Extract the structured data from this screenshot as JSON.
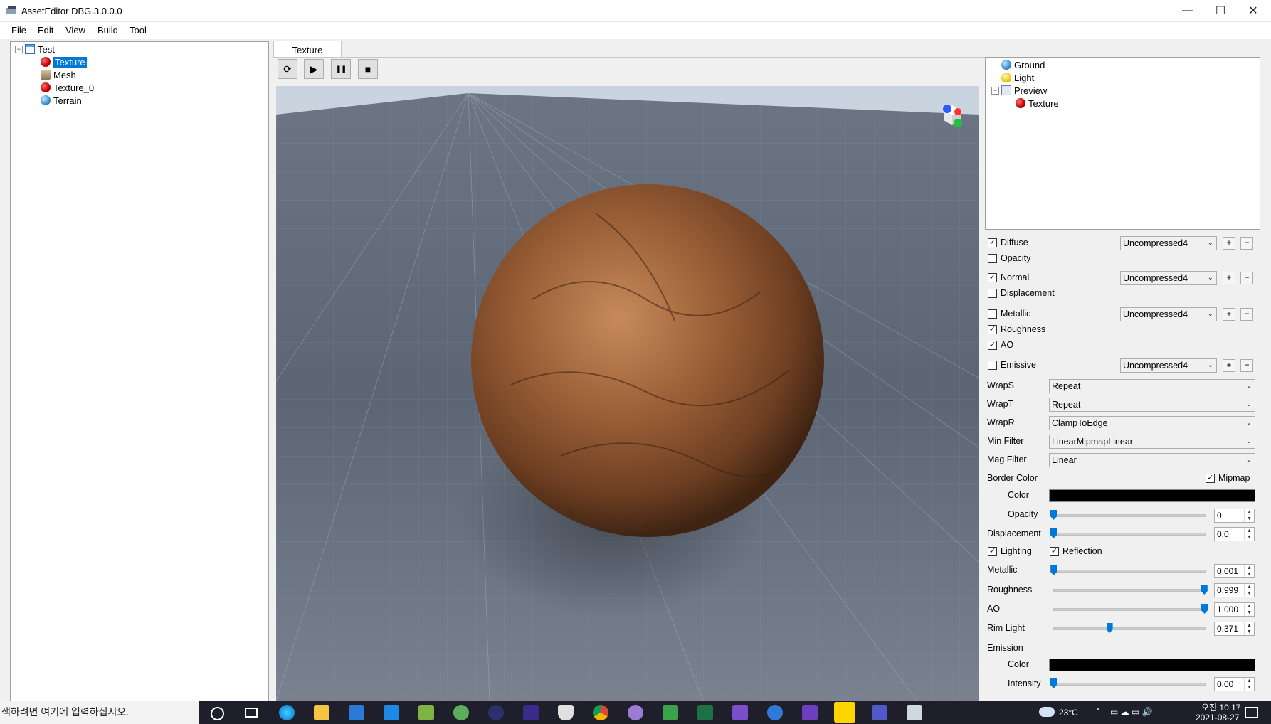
{
  "window": {
    "title": "AssetEditor DBG.3.0.0.0",
    "min_glyph": "—",
    "max_glyph": "☐",
    "close_glyph": "✕"
  },
  "menu": [
    "File",
    "Edit",
    "View",
    "Build",
    "Tool"
  ],
  "asset_tree": {
    "root": "Test",
    "items": [
      "Texture",
      "Mesh",
      "Texture_0",
      "Terrain"
    ],
    "selected": "Texture"
  },
  "tab": {
    "label": "Texture"
  },
  "toolbar": {
    "reload_icon": "⟳",
    "play_icon": "▶",
    "pause_icon": "❚❚",
    "stop_icon": "■"
  },
  "scene_tree": {
    "items": [
      "Ground",
      "Light",
      "Preview"
    ],
    "child": "Texture"
  },
  "maps": [
    {
      "label": "Diffuse",
      "checked": true,
      "format": "Uncompressed4"
    },
    {
      "label": "Opacity",
      "checked": false
    },
    {
      "label": "Normal",
      "checked": true,
      "format": "Uncompressed4"
    },
    {
      "label": "Displacement",
      "checked": false
    },
    {
      "label": "Metallic",
      "checked": false,
      "format": "Uncompressed4"
    },
    {
      "label": "Roughness",
      "checked": true
    },
    {
      "label": "AO",
      "checked": true
    },
    {
      "label": "Emissive",
      "checked": false,
      "format": "Uncompressed4"
    }
  ],
  "plus_label": "+",
  "minus_label": "−",
  "wrap": {
    "wraps_label": "WrapS",
    "wraps_value": "Repeat",
    "wrapt_label": "WrapT",
    "wrapt_value": "Repeat",
    "wrapr_label": "WrapR",
    "wrapr_value": "ClampToEdge",
    "minfilter_label": "Min Filter",
    "minfilter_value": "LinearMipmapLinear",
    "magfilter_label": "Mag Filter",
    "magfilter_value": "Linear"
  },
  "border": {
    "label": "Border Color",
    "mipmap_label": "Mipmap",
    "mipmap_checked": true,
    "color_label": "Color",
    "color_value": "#000000",
    "opacity_label": "Opacity",
    "opacity_value": "0",
    "opacity_fraction": 0
  },
  "displacement": {
    "label": "Displacement",
    "value": "0,0",
    "fraction": 0
  },
  "lighting": {
    "label": "Lighting",
    "checked": true
  },
  "reflection": {
    "label": "Reflection",
    "checked": true
  },
  "metallic": {
    "label": "Metallic",
    "value": "0,001",
    "fraction": 0.001
  },
  "roughness": {
    "label": "Roughness",
    "value": "0,999",
    "fraction": 0.999
  },
  "ao": {
    "label": "AO",
    "value": "1,000",
    "fraction": 1.0
  },
  "rimlight": {
    "label": "Rim Light",
    "value": "0,371",
    "fraction": 0.371
  },
  "emission": {
    "label": "Emission",
    "color_label": "Color",
    "color_value": "#000000",
    "intensity_label": "Intensity",
    "intensity_value": "0,00",
    "intensity_fraction": 0
  },
  "taskbar": {
    "search_placeholder": "색하려면 여기에 입력하십시오.",
    "weather": "23°C",
    "time": "오전 10:17",
    "date": "2021-08-27"
  }
}
